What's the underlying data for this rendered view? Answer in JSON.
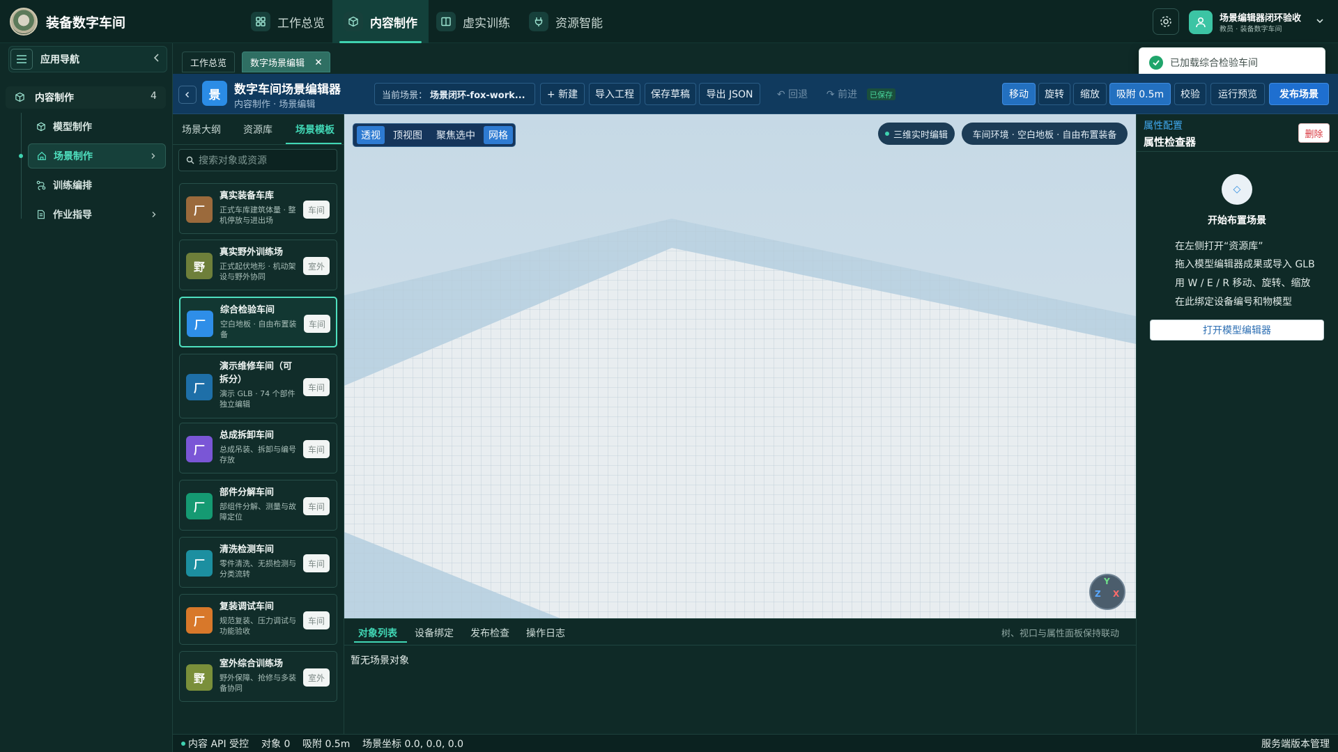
{
  "app": {
    "title": "装备数字车间"
  },
  "topnav": [
    {
      "label": "工作总览",
      "icon": "grid-icon"
    },
    {
      "label": "内容制作",
      "icon": "cube-icon",
      "active": true
    },
    {
      "label": "虚实训练",
      "icon": "book-icon"
    },
    {
      "label": "资源智能",
      "icon": "plug-icon"
    }
  ],
  "user": {
    "name": "场景编辑器闭环验收",
    "role": "教员 · 装备数字车间"
  },
  "appnav": {
    "title": "应用导航",
    "root": {
      "label": "内容制作",
      "count": "4"
    },
    "items": [
      {
        "label": "模型制作",
        "icon": "cube-icon"
      },
      {
        "label": "场景制作",
        "icon": "home-icon",
        "active": true
      },
      {
        "label": "训练编排",
        "icon": "flow-icon"
      },
      {
        "label": "作业指导",
        "icon": "doc-icon"
      }
    ]
  },
  "workspace_tabs": [
    {
      "label": "工作总览"
    },
    {
      "label": "数字场景编辑",
      "active": true,
      "closable": true
    }
  ],
  "toast": {
    "text": "已加载综合检验车间"
  },
  "editor": {
    "logo": "景",
    "title": "数字车间场景编辑器",
    "subtitle": "内容制作 · 场景编辑",
    "scene_label": "当前场景：",
    "scene_value": "场景闭环-fox-work...",
    "new_label": "+ 新建",
    "import_label": "导入工程",
    "save_draft_label": "保存草稿",
    "export_label": "导出 JSON",
    "undo_label": "↶ 回退",
    "redo_label": "↷ 前进",
    "saved_badge": "已保存",
    "modes": {
      "move": "移动",
      "rotate": "旋转",
      "scale": "缩放",
      "snap": "吸附 0.5m"
    },
    "validate_label": "校验",
    "preview_label": "运行预览",
    "publish_label": "发布场景"
  },
  "library": {
    "tabs": [
      {
        "label": "场景大纲"
      },
      {
        "label": "资源库"
      },
      {
        "label": "场景模板",
        "active": true
      }
    ],
    "search_placeholder": "搜索对象或资源",
    "cards": [
      {
        "badge": "厂",
        "color": "#9b6a3c",
        "title": "真实装备车库",
        "desc": "正式车库建筑体量 · 整机停放与进出场",
        "tag": "车间"
      },
      {
        "badge": "野",
        "color": "#6e7f3a",
        "title": "真实野外训练场",
        "desc": "正式起伏地形 · 机动架设与野外协同",
        "tag": "室外"
      },
      {
        "badge": "厂",
        "color": "#2e8ee8",
        "title": "综合检验车间",
        "desc": "空白地板 · 自由布置装备",
        "tag": "车间",
        "active": true
      },
      {
        "badge": "厂",
        "color": "#1e6fa8",
        "title": "演示维修车间（可拆分）",
        "desc": "演示 GLB · 74 个部件独立编辑",
        "tag": "车间"
      },
      {
        "badge": "厂",
        "color": "#7a56d6",
        "title": "总成拆卸车间",
        "desc": "总成吊装、拆卸与编号存放",
        "tag": "车间"
      },
      {
        "badge": "厂",
        "color": "#159a72",
        "title": "部件分解车间",
        "desc": "部组件分解、测量与故障定位",
        "tag": "车间"
      },
      {
        "badge": "厂",
        "color": "#1c8fa0",
        "title": "清洗检测车间",
        "desc": "零件清洗、无损检测与分类流转",
        "tag": "车间"
      },
      {
        "badge": "厂",
        "color": "#d8782a",
        "title": "复装调试车间",
        "desc": "规范复装、压力调试与功能验收",
        "tag": "车间"
      },
      {
        "badge": "野",
        "color": "#7a8f3a",
        "title": "室外综合训练场",
        "desc": "野外保障、抢修与多装备协同",
        "tag": "室外"
      }
    ]
  },
  "viewport": {
    "view_buttons": [
      {
        "label": "透视",
        "on": true
      },
      {
        "label": "顶视图"
      },
      {
        "label": "聚焦选中"
      },
      {
        "label": "网格",
        "on": true
      }
    ],
    "live_label": "三维实时编辑",
    "env_label": "车间环境 · 空白地板 · 自由布置装备",
    "axes": {
      "x": "X",
      "y": "Y",
      "z": "Z"
    }
  },
  "bottom_panel": {
    "tabs": [
      {
        "label": "对象列表",
        "active": true
      },
      {
        "label": "设备绑定"
      },
      {
        "label": "发布检查"
      },
      {
        "label": "操作日志"
      }
    ],
    "hint": "树、视口与属性面板保持联动",
    "empty": "暂无场景对象"
  },
  "inspector": {
    "kicker": "属性配置",
    "title": "属性检查器",
    "delete_label": "删除",
    "icon_glyph": "◇",
    "heading": "开始布置场景",
    "steps": [
      "在左侧打开“资源库”",
      "拖入模型编辑器成果或导入 GLB",
      "用 W / E / R 移动、旋转、缩放",
      "在此绑定设备编号和物模型"
    ],
    "open_editor_label": "打开模型编辑器"
  },
  "status": {
    "api": "内容 API 受控",
    "objects": "对象 0",
    "snap": "吸附 0.5m",
    "coords": "场景坐标 0.0, 0.0, 0.0",
    "right": "服务端版本管理"
  },
  "colors": {
    "accent": "#41d7b5",
    "header": "#103a5e",
    "primary": "#1e6fd0",
    "danger": "#d9363e"
  }
}
